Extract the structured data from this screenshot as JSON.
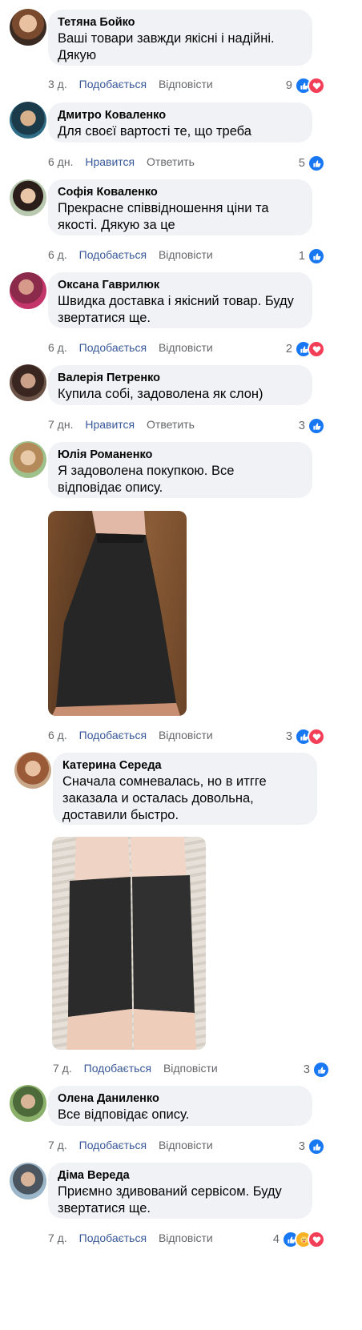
{
  "comments": [
    {
      "author": "Тетяна Бойко",
      "text": "Ваші товари завжди якісні і надійні.\nДякую",
      "time": "3 д.",
      "like_label": "Подобається",
      "reply_label": "Відповісти",
      "count": "9",
      "reactions": [
        "like-icon",
        "love-icon"
      ]
    },
    {
      "author": "Дмитро Коваленко",
      "text": "Для своєї вартості те, що треба",
      "time": "6 дн.",
      "like_label": "Нравится",
      "reply_label": "Ответить",
      "count": "5",
      "reactions": [
        "like-icon"
      ]
    },
    {
      "author": "Софія Коваленко",
      "text": "Прекрасне співвідношення ціни та\nякості. Дякую за це",
      "time": "6 д.",
      "like_label": "Подобається",
      "reply_label": "Відповісти",
      "count": "1",
      "reactions": [
        "like-icon"
      ]
    },
    {
      "author": "Оксана Гаврилюк",
      "text": "Швидка доставка і якісний товар. Буду\nзвертатися ще.",
      "time": "6 д.",
      "like_label": "Подобається",
      "reply_label": "Відповісти",
      "count": "2",
      "reactions": [
        "like-icon",
        "love-icon"
      ]
    },
    {
      "author": "Валерія Петренко",
      "text": "Купила собі, задоволена як слон)",
      "time": "7 дн.",
      "like_label": "Нравится",
      "reply_label": "Ответить",
      "count": "3",
      "reactions": [
        "like-icon"
      ]
    },
    {
      "author": "Юлія Романенко",
      "text": "Я задоволена покупкою. Все\nвідповідає опису.",
      "time": "6 д.",
      "like_label": "Подобається",
      "reply_label": "Відповісти",
      "count": "3",
      "reactions": [
        "like-icon",
        "love-icon"
      ]
    },
    {
      "author": "Катерина Середа",
      "text": "Сначала сомневалась, но в итгге\nзаказала и осталась довольна,\nдоставили быстро.",
      "time": "7 д.",
      "like_label": "Подобається",
      "reply_label": "Відповісти",
      "count": "3",
      "reactions": [
        "like-icon"
      ]
    },
    {
      "author": "Олена Даниленко",
      "text": "Все відповідає опису.",
      "time": "7 д.",
      "like_label": "Подобається",
      "reply_label": "Відповісти",
      "count": "3",
      "reactions": [
        "like-icon"
      ]
    },
    {
      "author": "Діма Вереда",
      "text": "Приємно здивований сервісом. Буду\nзвертатися ще.",
      "time": "7 д.",
      "like_label": "Подобається",
      "reply_label": "Відповісти",
      "count": "4",
      "reactions": [
        "like-icon",
        "care-icon",
        "love-icon"
      ]
    }
  ],
  "colors": {
    "link": "#385898",
    "meta": "#65676b",
    "bubble": "#f0f2f5",
    "like": "#1877f2",
    "love": "#f33e58",
    "care": "#f7b125"
  }
}
